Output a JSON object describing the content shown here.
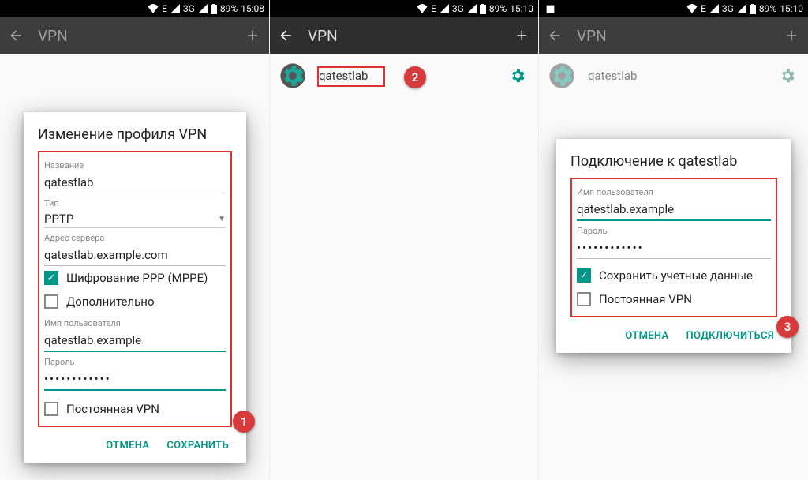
{
  "status": {
    "net1": "E",
    "net2": "3G",
    "battery": "89%",
    "time1": "15:08",
    "time2": "15:10",
    "time3": "15:10"
  },
  "appbar": {
    "title": "VPN"
  },
  "vpnrow": {
    "name": "qatestlab"
  },
  "dialog1": {
    "title": "Изменение профиля VPN",
    "name_label": "Название",
    "name_value": "qatestlab",
    "type_label": "Тип",
    "type_value": "PPTP",
    "server_label": "Адрес сервера",
    "server_value": "qatestlab.example.com",
    "ppp_label": "Шифрование PPP (MPPE)",
    "adv_label": "Дополнительно",
    "user_label": "Имя пользователя",
    "user_value": "qatestlab.example",
    "pass_label": "Пароль",
    "pass_value": "••••••••••••",
    "perm_label": "Постоянная VPN",
    "cancel": "ОТМЕНА",
    "save": "СОХРАНИТЬ"
  },
  "dialog2": {
    "title": "Подключение к qatestlab",
    "user_label": "Имя пользователя",
    "user_value": "qatestlab.example",
    "pass_label": "Пароль",
    "pass_value": "••••••••••••",
    "save_creds": "Сохранить учетные данные",
    "perm_label": "Постоянная VPN",
    "cancel": "ОТМЕНА",
    "connect": "ПОДКЛЮЧИТЬСЯ"
  },
  "badges": {
    "b1": "1",
    "b2": "2",
    "b3": "3"
  }
}
